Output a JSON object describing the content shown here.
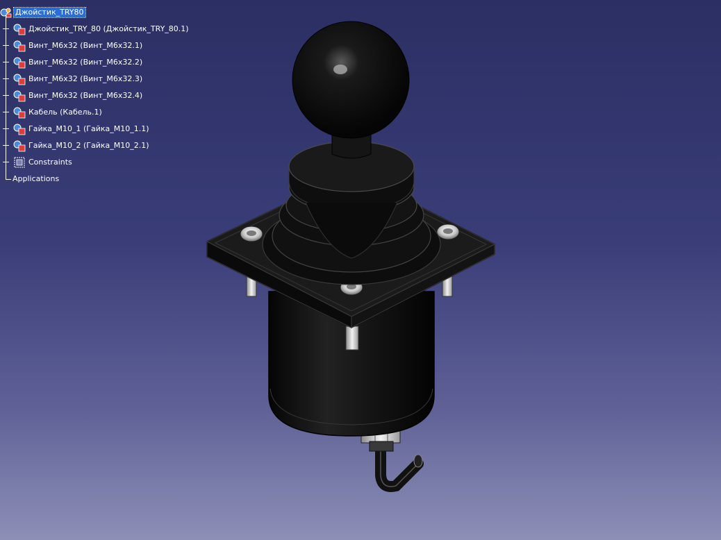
{
  "tree": {
    "root": {
      "label": "Джойстик_TRY80",
      "icon": "product-icon"
    },
    "children": [
      {
        "label": "Джойстик_TRY_80 (Джойстик_TRY_80.1)",
        "icon": "part-icon",
        "expandable": true
      },
      {
        "label": "Винт_M6x32 (Винт_M6x32.1)",
        "icon": "part-icon",
        "expandable": true
      },
      {
        "label": "Винт_M6x32 (Винт_M6x32.2)",
        "icon": "part-icon",
        "expandable": true
      },
      {
        "label": "Винт_M6x32 (Винт_M6x32.3)",
        "icon": "part-icon",
        "expandable": true
      },
      {
        "label": "Винт_M6x32 (Винт_M6x32.4)",
        "icon": "part-icon",
        "expandable": true
      },
      {
        "label": "Кабель (Кабель.1)",
        "icon": "part-icon",
        "expandable": true
      },
      {
        "label": "Гайка_M10_1 (Гайка_M10_1.1)",
        "icon": "part-icon",
        "expandable": true
      },
      {
        "label": "Гайка_M10_2 (Гайка_M10_2.1)",
        "icon": "part-icon",
        "expandable": true
      },
      {
        "label": "Constraints",
        "icon": "constraints-icon",
        "expandable": true
      },
      {
        "label": "Applications",
        "icon": "",
        "expandable": false
      }
    ]
  },
  "viewport": {
    "background_top": "#2b2f63",
    "background_bottom": "#8d8fb7",
    "model": "joystick-assembly"
  }
}
